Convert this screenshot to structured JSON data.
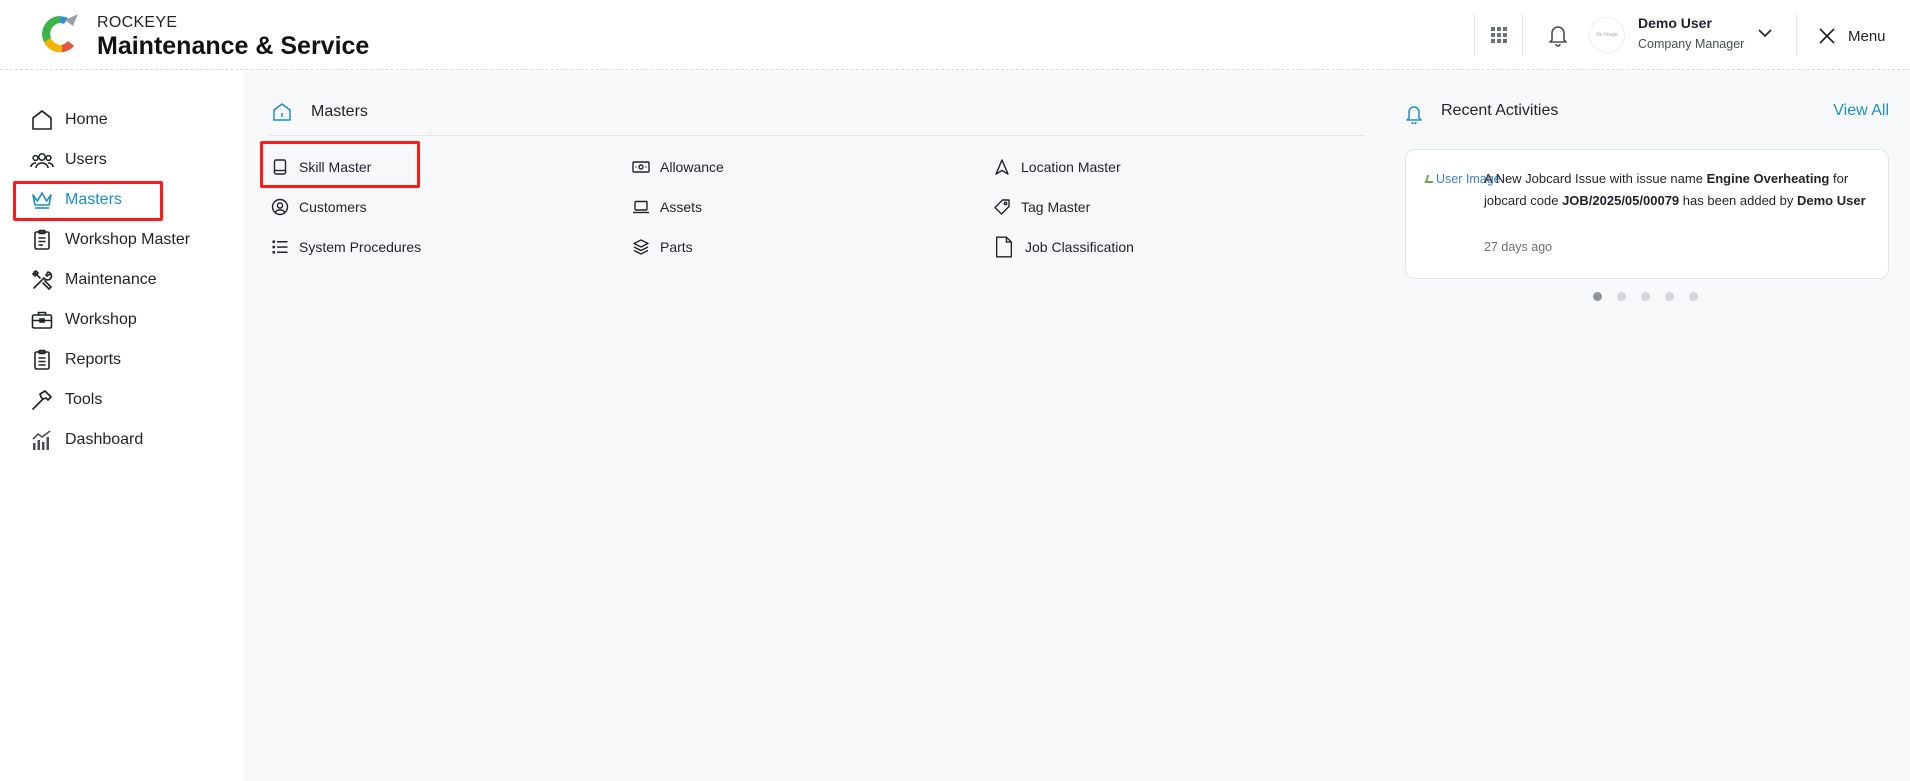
{
  "brand": {
    "top": "ROCKEYE",
    "main": "Maintenance & Service"
  },
  "user": {
    "name": "Demo User",
    "role": "Company Manager",
    "avatar_text": "No Image"
  },
  "header": {
    "menu_label": "Menu"
  },
  "sidebar": {
    "items": [
      {
        "label": "Home",
        "icon": "home-icon"
      },
      {
        "label": "Users",
        "icon": "users-icon"
      },
      {
        "label": "Masters",
        "icon": "crown-icon",
        "active": true
      },
      {
        "label": "Workshop Master",
        "icon": "clipboard-icon"
      },
      {
        "label": "Maintenance",
        "icon": "tools-icon"
      },
      {
        "label": "Workshop",
        "icon": "toolbox-icon"
      },
      {
        "label": "Reports",
        "icon": "report-icon"
      },
      {
        "label": "Tools",
        "icon": "hammer-icon"
      },
      {
        "label": "Dashboard",
        "icon": "chart-icon"
      }
    ]
  },
  "masters": {
    "title": "Masters",
    "items": [
      {
        "label": "Skill Master",
        "icon": "book-icon"
      },
      {
        "label": "Allowance",
        "icon": "banknote-icon"
      },
      {
        "label": "Location Master",
        "icon": "navigation-icon"
      },
      {
        "label": "Customers",
        "icon": "user-circle-icon"
      },
      {
        "label": "Assets",
        "icon": "laptop-icon"
      },
      {
        "label": "Tag Master",
        "icon": "tag-icon"
      },
      {
        "label": "System Procedures",
        "icon": "list-icon"
      },
      {
        "label": "Parts",
        "icon": "layers-icon"
      },
      {
        "label": "Job Classification",
        "icon": "document-icon"
      }
    ]
  },
  "recent_activities": {
    "title": "Recent Activities",
    "view_all": "View All",
    "card": {
      "image_alt": "User Image",
      "text_1": "A New Jobcard Issue with issue name ",
      "issue_name": "Engine Overheating",
      "text_2": " for jobcard code ",
      "jobcard_code": "JOB/2025/05/00079",
      "text_3": " has been added by ",
      "added_by": "Demo User",
      "time": "27 days ago"
    },
    "pages": 5,
    "current_page": 1
  }
}
